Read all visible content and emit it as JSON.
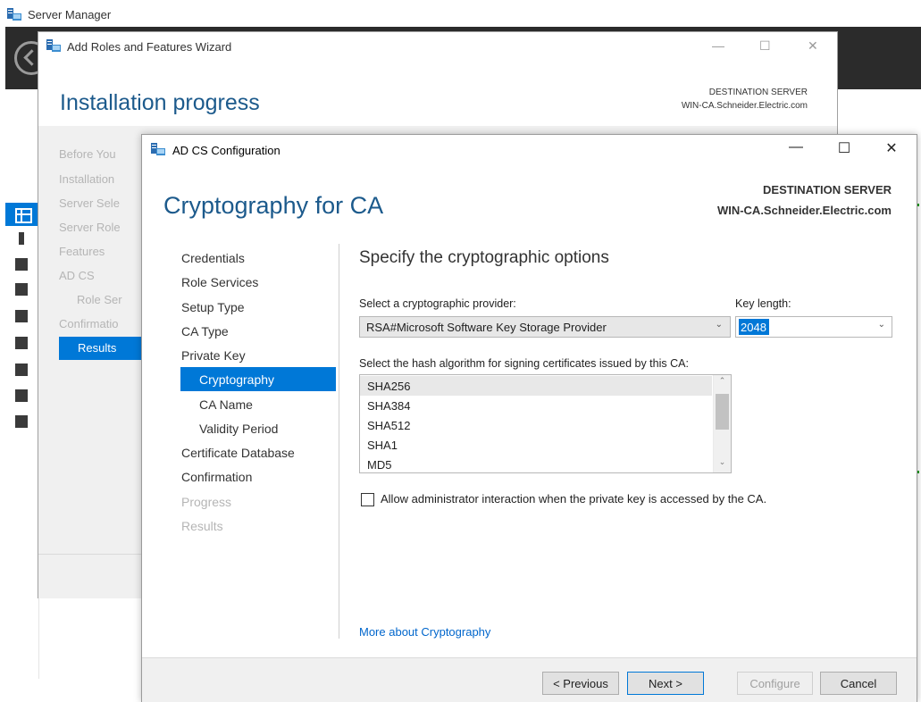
{
  "server_manager": {
    "title": "Server Manager"
  },
  "wizard": {
    "title": "Add Roles and Features Wizard",
    "heading": "Installation progress",
    "destination_label": "DESTINATION SERVER",
    "destination_value": "WIN-CA.Schneider.Electric.com",
    "window_controls": {
      "minimize": "—",
      "maximize": "☐",
      "close": "✕"
    },
    "nav": [
      {
        "label": "Before You"
      },
      {
        "label": "Installation"
      },
      {
        "label": "Server Sele"
      },
      {
        "label": "Server Role"
      },
      {
        "label": "Features"
      },
      {
        "label": "AD CS"
      },
      {
        "label": "Role Ser"
      },
      {
        "label": "Confirmatio"
      },
      {
        "label": "Results"
      }
    ]
  },
  "adcs": {
    "title": "AD CS Configuration",
    "window_controls": {
      "minimize": "—",
      "maximize": "☐",
      "close": "✕"
    },
    "heading": "Cryptography for CA",
    "destination_label": "DESTINATION SERVER",
    "destination_value": "WIN-CA.Schneider.Electric.com",
    "nav": [
      {
        "label": "Credentials",
        "state": "enabled"
      },
      {
        "label": "Role Services",
        "state": "enabled"
      },
      {
        "label": "Setup Type",
        "state": "enabled"
      },
      {
        "label": "CA Type",
        "state": "enabled"
      },
      {
        "label": "Private Key",
        "state": "enabled"
      },
      {
        "label": "Cryptography",
        "state": "selected"
      },
      {
        "label": "CA Name",
        "state": "enabled"
      },
      {
        "label": "Validity Period",
        "state": "enabled"
      },
      {
        "label": "Certificate Database",
        "state": "enabled"
      },
      {
        "label": "Confirmation",
        "state": "enabled"
      },
      {
        "label": "Progress",
        "state": "disabled"
      },
      {
        "label": "Results",
        "state": "disabled"
      }
    ],
    "section_title": "Specify the cryptographic options",
    "provider_label": "Select a cryptographic provider:",
    "provider_value": "RSA#Microsoft Software Key Storage Provider",
    "key_length_label": "Key length:",
    "key_length_value": "2048",
    "hash_label": "Select the hash algorithm for signing certificates issued by this CA:",
    "hash_options": [
      "SHA256",
      "SHA384",
      "SHA512",
      "SHA1",
      "MD5"
    ],
    "hash_selected": "SHA256",
    "allow_interaction_label": "Allow administrator interaction when the private key is accessed by the CA.",
    "allow_interaction_checked": false,
    "more_link": "More about Cryptography",
    "buttons": {
      "previous": "< Previous",
      "next": "Next >",
      "configure": "Configure",
      "cancel": "Cancel"
    }
  },
  "colors": {
    "accent": "#0078d7",
    "heading": "#1c5a8c",
    "link": "#0066cc",
    "server_manager_band": "#2b2b2b"
  }
}
